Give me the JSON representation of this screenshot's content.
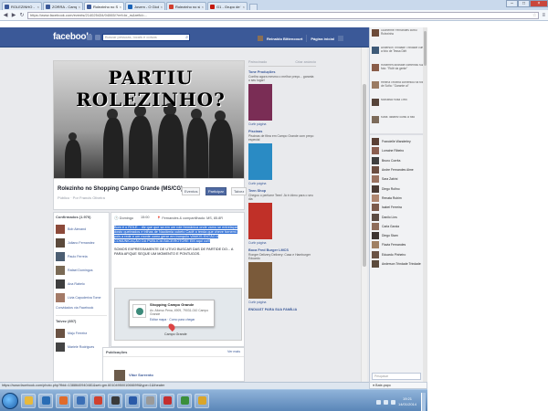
{
  "browser": {
    "tabs": [
      {
        "label": "ROLEZINHO - Campo Grande",
        "color": "#3b5998",
        "active": false
      },
      {
        "label": "ZORRA - Campo Grande",
        "color": "#3b5998",
        "active": false
      },
      {
        "label": "Rolezinho no Shopping C",
        "color": "#3b5998",
        "active": true
      },
      {
        "label": "Jovem - O Globo",
        "color": "#1a63b8",
        "active": false
      },
      {
        "label": "Rolezinho no shopping c",
        "color": "#d13d2e",
        "active": false
      },
      {
        "label": "G1 - Grupo de 'rolê' em",
        "color": "#c4170c",
        "active": false
      }
    ],
    "url": "https://www.facebook.com/events/214025434/04065/?ref=br_rs&refid=...",
    "status_url": "https://www.facebook.com/photo.php?fbid=1388640940481&set=gm.6010495001066699&type=1&theater"
  },
  "fb": {
    "logo": "facebook",
    "search_placeholder": "Buscar pessoas, locais e coisas",
    "user_name": "Reinaldo Bittencourt",
    "home_label": "Página inicial"
  },
  "event": {
    "cover_title": "PARTIU ROLEZINHO?",
    "title": "Rolezinho no Shopping Campo Grande (MS/CG)",
    "subtitle": "Público · Por Francis Oliveira",
    "btn_events": "Eventos",
    "btn_join": "Participar",
    "btn_more": "Talvez",
    "date": "Domingo",
    "time": "15:00",
    "place": "Fernandes & compartilhado: MS, 85.8R",
    "desc_highlight": "Bom é o ROLE... diz que que sa em um role fremânica onde vamo se entrelaçar dosto quebrados e trilhas de Naoiâmia cubeto Cadê a tenda que cheve fornemi, pois a rede e um monte como gerar em tronquilo VAMOS ENTÃO A COMUNICAÇÃO DA PUBLICIA BACEIROTORE EM aqui cu!!!",
    "desc_normal": "SOMOS EXPRESSAMENTE DE UTIVO BUSCAR DAS DE PARTIDE DO... A PARA AFIQUE SEQUE UM MOMENTO E PONTUGOS.",
    "map_title": "Shopping Campo Grande",
    "map_address": "Av. Afonso Pena, 4909, 79031-010 Campo Grande",
    "map_link": "Editar mapa · Como para chegar",
    "map_label": "Campo Grande"
  },
  "attendees": {
    "header": "Confirmados (1.970)",
    "people": [
      {
        "name": "Bob Alexand",
        "color": "#8c4a3a"
      },
      {
        "name": "Juliano Fernandez",
        "color": "#5b4a3c"
      },
      {
        "name": "Paulo Ferreia",
        "color": "#4c5e72"
      },
      {
        "name": "Rafael Domingos",
        "color": "#7a6a55"
      },
      {
        "name": "Ana Rabelo",
        "color": "#3e3e3e"
      },
      {
        "name": "Livia Capuderiva Tome",
        "color": "#a37a67"
      }
    ],
    "see_all": "Convidados via Facebook",
    "maybe_header": "Talvez (857)",
    "maybe_people": [
      {
        "name": "Maju Ferreira",
        "color": "#6a5243"
      },
      {
        "name": "Mariele Rodrigues",
        "color": "#444"
      }
    ]
  },
  "posts": {
    "header": "Publicações",
    "see_more": "Ver mais",
    "author": "Vitor Sorrento"
  },
  "ads": {
    "header": "Patrocinado",
    "header_link": "Criar anúncio",
    "items": [
      {
        "title": "Tone Produções",
        "desc": "Confira agora mesmo o melhor preço... garanta o seu lugar!",
        "color": "#7a2d55",
        "like": "Curtir página"
      },
      {
        "title": "Piscinas",
        "desc": "Piscinas de fibra em Campo Grande com preço especial",
        "color": "#2a8bc4",
        "like": "Curtir página"
      },
      {
        "title": "Teen Shop",
        "desc": "Chegou o perfume Teen! Já é ótimo para o seu dia",
        "color": "#c03028",
        "like": "Curtir página"
      },
      {
        "title": "Boca Fred Burger LMCS",
        "desc": "Ronger Delivery Delivery: Casa e Hamburger Eduardo",
        "color": "#7a5a3a",
        "like": "Curtir página"
      }
    ],
    "footer": "ENDIAST PARA SUA FAMÍLIA"
  },
  "chat": {
    "feed": [
      {
        "text": "Guilherme Fernandes curtiu Rolezinho",
        "color": "#6c4b3a"
      },
      {
        "text": "Anderson Trindade Trindade curtiu a foto de Tessa Dirit",
        "color": "#3e5a78"
      },
      {
        "text": "Rosemeri Andrade comentou sua foto: \"Rolê da gente\"",
        "color": "#8a5d49"
      },
      {
        "text": "Helena Teixeira comentou na foto de Sofia: \"Garante aí\"",
        "color": "#9a7b62"
      },
      {
        "text": "Monalisa Rosa 1990",
        "color": "#56443a"
      },
      {
        "text": "Karla Tabarez curtiu a foto",
        "color": "#7d6b5a"
      }
    ],
    "contacts": [
      {
        "name": "Francielle Wanderley",
        "color": "#5a3f34"
      },
      {
        "name": "Lorraine Ribeiro",
        "color": "#8a5e50"
      },
      {
        "name": "Bruno Corrêa",
        "color": "#3f3f3f"
      },
      {
        "name": "Andre Fernandes Alme",
        "color": "#6b4d40"
      },
      {
        "name": "Sara Zabini",
        "color": "#9a7260"
      },
      {
        "name": "Diego Rufino",
        "color": "#4a3a33"
      },
      {
        "name": "Renata Rubim",
        "color": "#b08770"
      },
      {
        "name": "Isabel Ferreira",
        "color": "#7c5b4c"
      },
      {
        "name": "Danilo Lins",
        "color": "#5b4b42"
      },
      {
        "name": "Carla Garcia",
        "color": "#8e6c59"
      },
      {
        "name": "Diego Stam",
        "color": "#3d3431"
      },
      {
        "name": "Flavia Fernandes",
        "color": "#a08063"
      },
      {
        "name": "Eduardo Pinheiro",
        "color": "#6a5244"
      }
    ],
    "bottom_name": "Anderson Trindade Trindade",
    "search_placeholder": "Pesquisar",
    "bar_label": "Bate-papo"
  },
  "taskbar": {
    "items": [
      {
        "color": "#e8b93c"
      },
      {
        "color": "#2a6db5"
      },
      {
        "color": "#e06b2b"
      },
      {
        "color": "#3b6fb6"
      },
      {
        "color": "#d0402f"
      },
      {
        "color": "#3a3a3a"
      },
      {
        "color": "#2a5aa8"
      },
      {
        "color": "#9a9a9a"
      },
      {
        "color": "#c42f2f"
      },
      {
        "color": "#3b8f3b"
      },
      {
        "color": "#d9a52a"
      }
    ],
    "time": "19:21",
    "date": "14/01/2014"
  }
}
